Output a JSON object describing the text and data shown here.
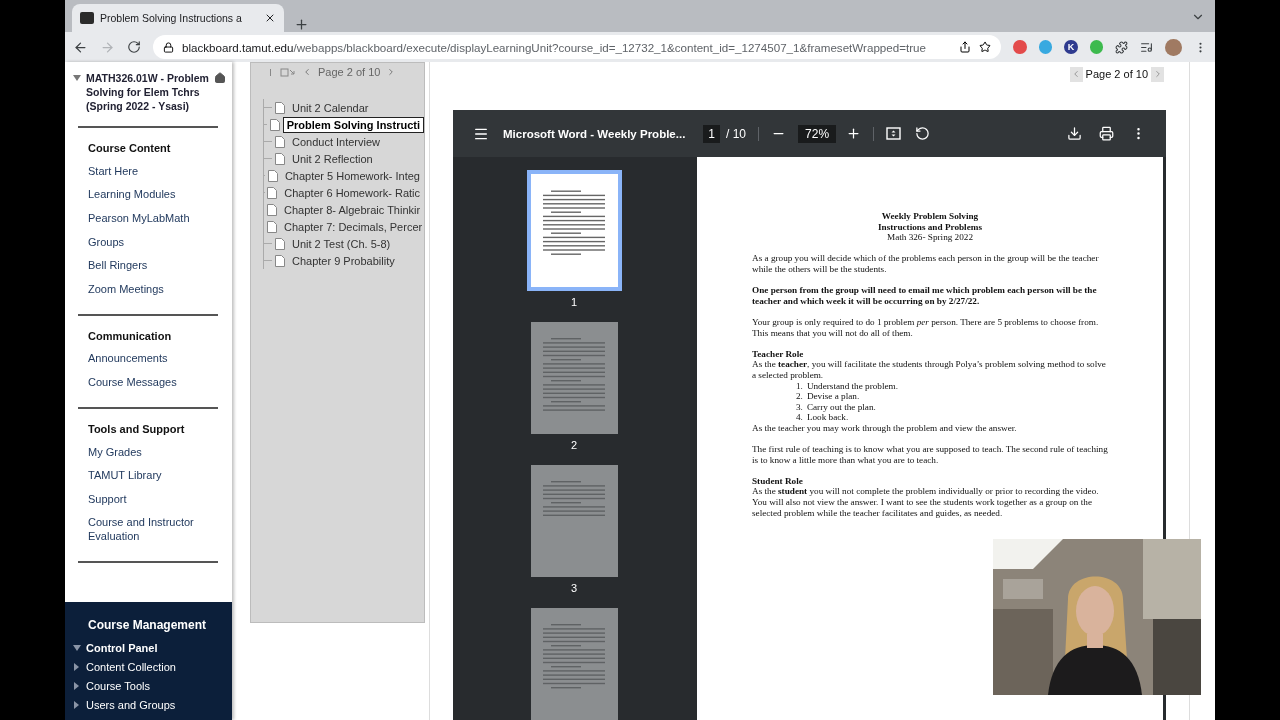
{
  "browser": {
    "tab": {
      "title": "Problem Solving Instructions a",
      "selected": true
    },
    "url": {
      "host": "blackboard.tamut.edu",
      "path": "/webapps/blackboard/execute/displayLearningUnit?course_id=_12732_1&content_id=_1274507_1&framesetWrapped=true"
    },
    "forward_disabled": true,
    "extension_letter": "K"
  },
  "course_menu": {
    "title": "MATH326.01W - Problem Solving for Elem Tchrs (Spring 2022 - Ysasi)",
    "expanded": true,
    "sections": [
      {
        "heading": "Course Content",
        "items": [
          "Start Here",
          "Learning Modules",
          "Pearson MyLabMath",
          "Groups",
          "Bell Ringers",
          "Zoom Meetings"
        ]
      },
      {
        "heading": "Communication",
        "items": [
          "Announcements",
          "Course Messages"
        ]
      },
      {
        "heading": "Tools and Support",
        "items": [
          "My Grades",
          "TAMUT Library",
          "Support",
          "Course and Instructor Evaluation"
        ]
      }
    ]
  },
  "management": {
    "title": "Course Management",
    "panel": {
      "label": "Control Panel",
      "expanded": true,
      "items": [
        {
          "label": "Content Collection",
          "expanded": false
        },
        {
          "label": "Course Tools",
          "expanded": false
        },
        {
          "label": "Users and Groups",
          "expanded": false
        }
      ]
    }
  },
  "unit_nav": {
    "pager": "Page 2 of 10",
    "items": [
      {
        "label": "Unit 2 Calendar",
        "selected": false
      },
      {
        "label": "Problem Solving Instructi",
        "selected": true
      },
      {
        "label": "Conduct Interview",
        "selected": false
      },
      {
        "label": "Unit 2 Reflection",
        "selected": false
      },
      {
        "label": "Chapter 5 Homework- Integ",
        "selected": false
      },
      {
        "label": "Chapter 6 Homework- Ratic",
        "selected": false
      },
      {
        "label": "Chapter 8- Algebraic Thinkir",
        "selected": false
      },
      {
        "label": "Chapter 7: Decimals, Percer",
        "selected": false
      },
      {
        "label": "Unit 2 Test (Ch. 5-8)",
        "selected": false
      },
      {
        "label": "Chapter 9 Probability",
        "selected": false
      }
    ]
  },
  "page_nav": {
    "label": "Page 2 of 10"
  },
  "pdf_viewer": {
    "title": "Microsoft Word - Weekly Proble...",
    "page": "1",
    "total": "/ 10",
    "zoom": "72%",
    "thumbnails": [
      {
        "label": "1",
        "selected": true
      },
      {
        "label": "2",
        "selected": false
      },
      {
        "label": "3",
        "selected": false
      },
      {
        "selected": false
      }
    ],
    "document": {
      "title_lines": [
        "Weekly Problem Solving",
        "Instructions and Problems"
      ],
      "subtitle": "Math 326- Spring 2022",
      "blocks": [
        {
          "kind": "paragraph",
          "text": "As a group you will decide which of the problems each person in the group will be the teacher while the others will be the students."
        },
        {
          "kind": "strong",
          "text": "One person from the group will need to email me which problem each person will be the teacher and which week it will be occurring on by 2/27/22."
        },
        {
          "kind": "paragraph",
          "text": "Your group is only required to do 1 problem *per* person. There are 5 problems to choose from. This means that you will not do all of them."
        },
        {
          "kind": "heading",
          "text": "Teacher Role"
        },
        {
          "kind": "paragraph",
          "text": "As the **teacher**, you will facilitate the students through Polya’s problem solving method to solve a selected problem."
        },
        {
          "kind": "list",
          "items": [
            {
              "number": "1.",
              "text": "Understand the problem."
            },
            {
              "number": "2.",
              "text": "Devise a plan."
            },
            {
              "number": "3.",
              "text": "Carry out the plan."
            },
            {
              "number": "4.",
              "text": "Look back."
            }
          ]
        },
        {
          "kind": "paragraph",
          "text": "As the teacher you may work through the problem and view the answer."
        },
        {
          "kind": "paragraph",
          "text": "The first rule of teaching is to know what you are supposed to teach. The second rule of teaching is to know a little more than what you are to teach."
        },
        {
          "kind": "heading",
          "text": "Student Role"
        },
        {
          "kind": "paragraph",
          "text": "As the **student** you will not complete the problem individually or prior to recording the video. You will also not view the answer. I want to see the students work together as a group on the selected problem while the teacher facilitates and guides, as needed."
        }
      ]
    }
  }
}
